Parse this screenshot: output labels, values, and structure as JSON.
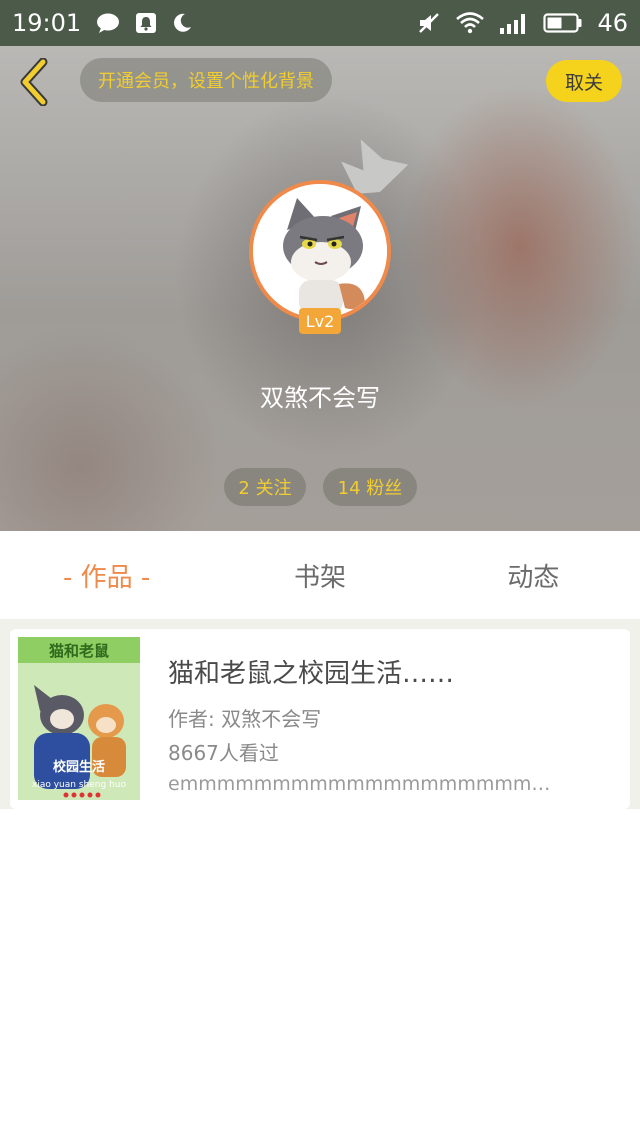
{
  "status_bar": {
    "time": "19:01",
    "battery": "46",
    "icons": [
      "chat-bubble-icon",
      "notification-icon",
      "moon-icon",
      "mute-icon",
      "wifi-icon",
      "signal-icon",
      "battery-icon"
    ]
  },
  "header": {
    "back_icon": "chevron-left-icon",
    "vip_prompt": "开通会员，设置个性化背景",
    "unfollow_label": "取关",
    "level": "Lv2",
    "username": "双煞不会写",
    "following": "2 关注",
    "fans": "14 粉丝"
  },
  "tabs": [
    {
      "label": "- 作品 -",
      "active": true
    },
    {
      "label": "书架",
      "active": false
    },
    {
      "label": "动态",
      "active": false
    }
  ],
  "works": [
    {
      "title": "猫和老鼠之校园生活……",
      "author": "作者: 双煞不会写",
      "views": "8667人看过",
      "description": "emmmmmmmmmmmmmmmmmmmmmm…",
      "cover_text": {
        "top": "猫和老鼠",
        "mid": "校园生活",
        "bottom": "xiao yuan sheng huo"
      }
    }
  ],
  "colors": {
    "status_bar": "#4b5a49",
    "accent_orange": "#ee8a4c",
    "accent_yellow": "#f5d31c",
    "pill_text": "#f2cd2f"
  }
}
